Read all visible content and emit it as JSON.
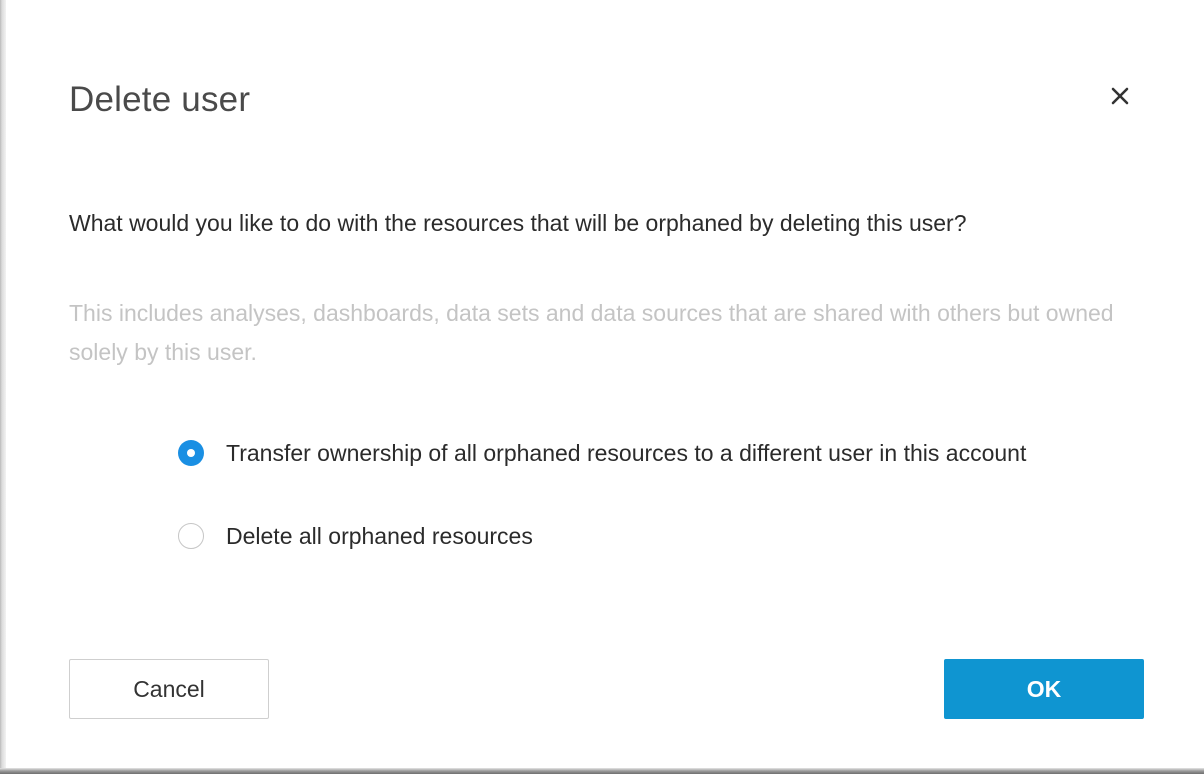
{
  "dialog": {
    "title": "Delete user",
    "close_icon": "close-icon",
    "question": "What would you like to do with the resources that will be orphaned by deleting this user?",
    "description": "This includes analyses, dashboards, data sets and data sources that are shared with others but owned solely by this user.",
    "options": [
      {
        "label": "Transfer ownership of all orphaned resources to a different user in this account",
        "selected": true
      },
      {
        "label": "Delete all orphaned resources",
        "selected": false
      }
    ],
    "cancel_label": "Cancel",
    "ok_label": "OK"
  },
  "colors": {
    "accent": "#1a8fe3",
    "ok_button": "#0f95d1",
    "title_text": "#4a4a4a",
    "muted_text": "#c4c4c4"
  }
}
